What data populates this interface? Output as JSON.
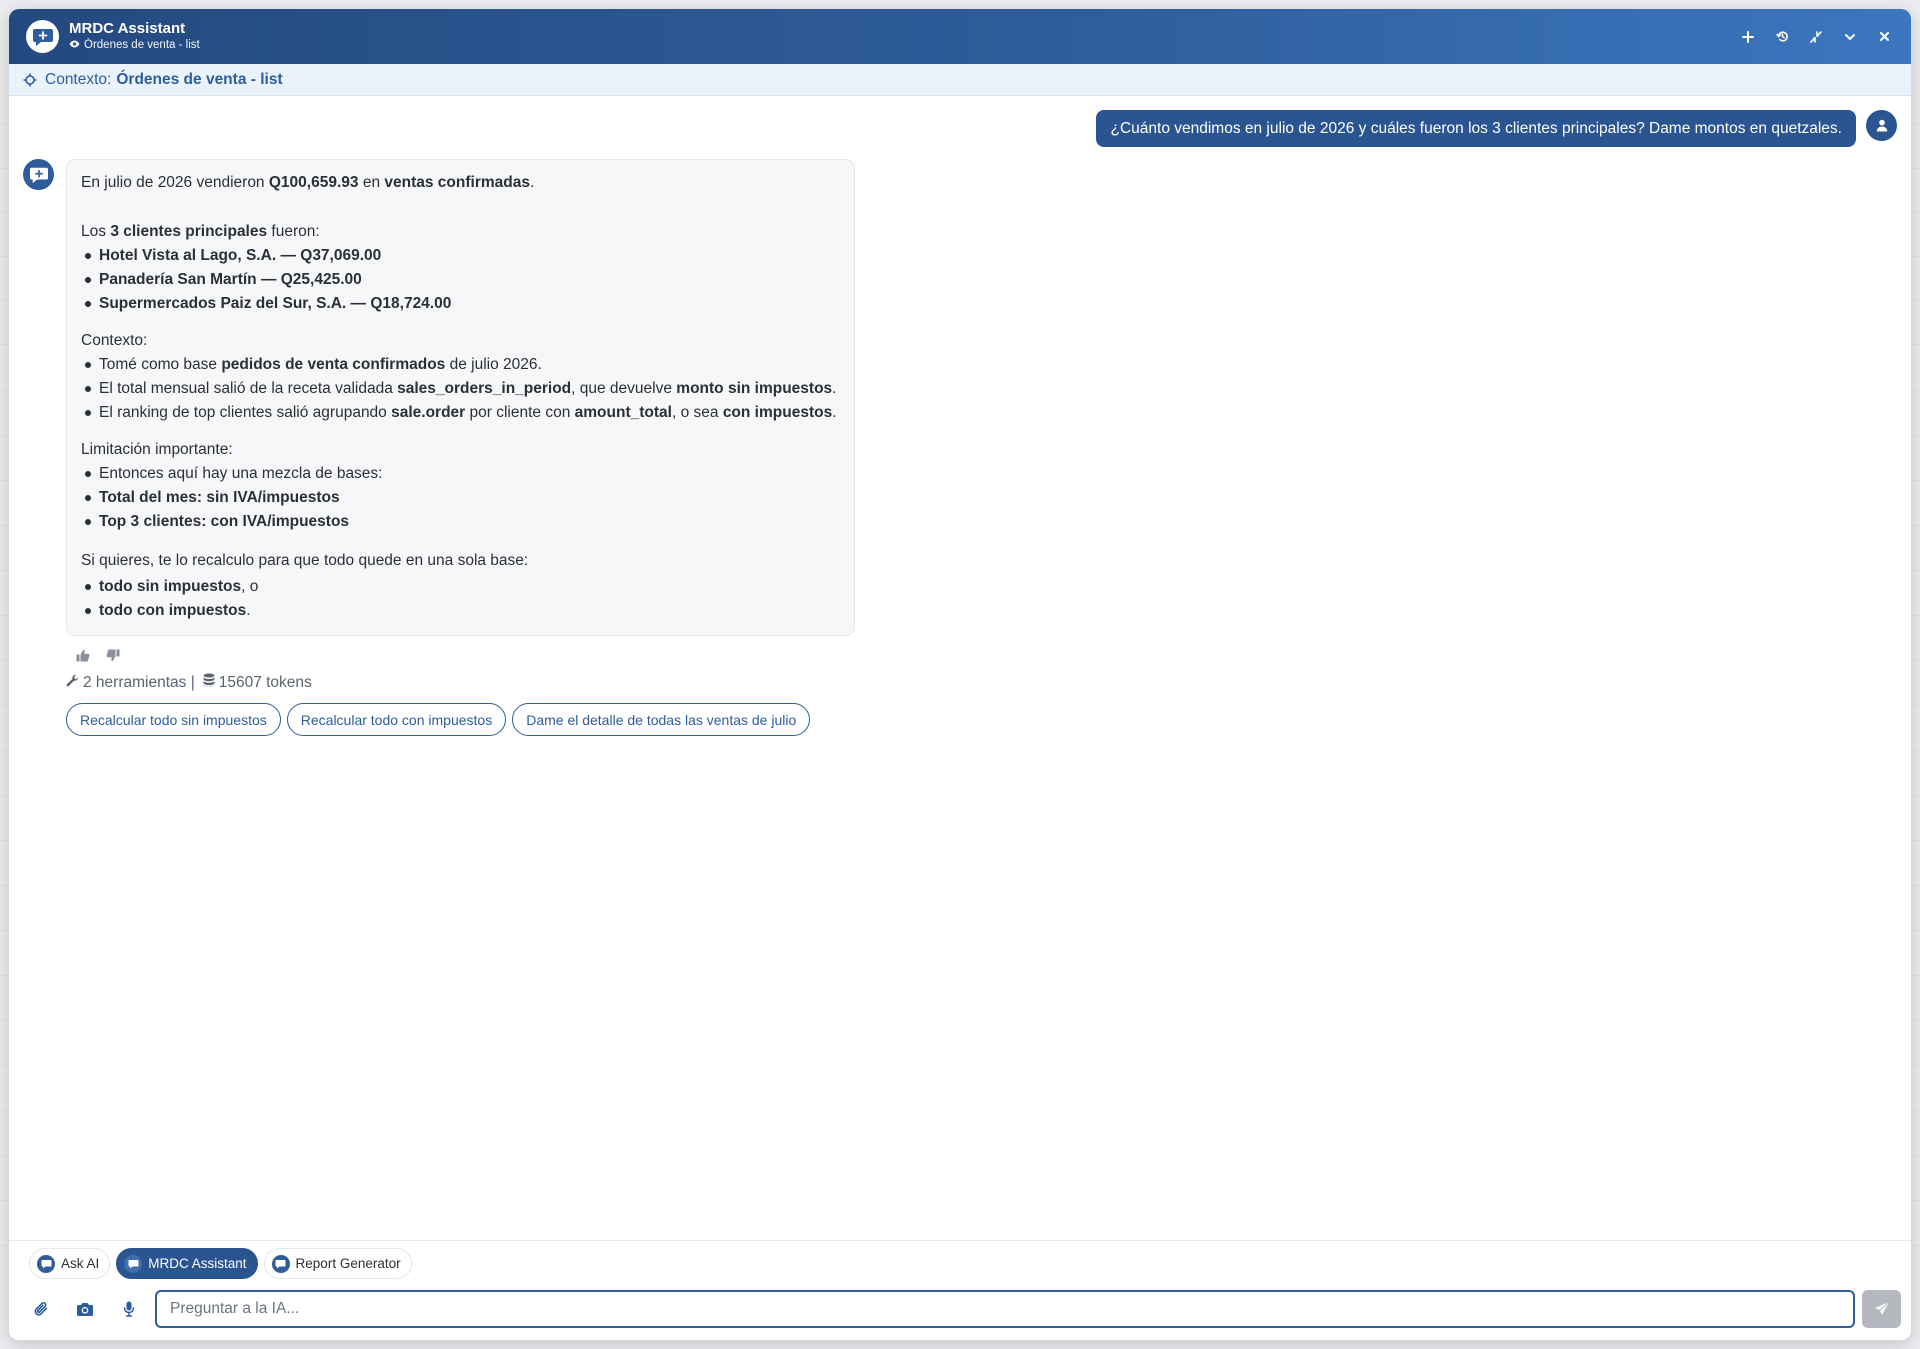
{
  "window": {
    "title": "MRDC Assistant",
    "subtitle": "Órdenes de venta - list"
  },
  "context": {
    "label": "Contexto:",
    "value": "Órdenes de venta - list"
  },
  "user_message": "¿Cuánto vendimos en julio de 2026 y cuáles fueron los 3 clientes principales? Dame montos en quetzales.",
  "bot_message": {
    "intro": {
      "p1": "En julio de 2026 vendieron ",
      "b1": "Q100,659.93",
      "p2": " en ",
      "b2": "ventas confirmadas",
      "p3": "."
    },
    "top_intro": {
      "p1": "Los ",
      "b1": "3 clientes principales",
      "p2": " fueron:"
    },
    "top_clients": [
      "Hotel Vista al Lago, S.A. — Q37,069.00",
      "Panadería San Martín — Q25,425.00",
      "Supermercados Paiz del Sur, S.A. — Q18,724.00"
    ],
    "context_heading": "Contexto:",
    "context_items": [
      {
        "t1": "Tomé como base ",
        "b1": "pedidos de venta confirmados",
        "t2": " de julio 2026.",
        "b2": "",
        "t3": "",
        "b3": "",
        "t4": ""
      },
      {
        "t1": "El total mensual salió de la receta validada ",
        "b1": "sales_orders_in_period",
        "t2": ", que devuelve ",
        "b2": "monto sin impuestos",
        "t3": ".",
        "b3": "",
        "t4": ""
      },
      {
        "t1": "El ranking de top clientes salió agrupando ",
        "b1": "sale.order",
        "t2": " por cliente con ",
        "b2": "amount_total",
        "t3": ", o sea ",
        "b3": "con impuestos",
        "t4": "."
      }
    ],
    "limitation_heading": "Limitación importante:",
    "limitation_items": {
      "item1": "Entonces aquí hay una mezcla de bases:",
      "item2": "Total del mes: sin IVA/impuestos",
      "item3": "Top 3 clientes: con IVA/impuestos"
    },
    "offer": "Si quieres, te lo recalculo para que todo quede en una sola base:",
    "offer_items": [
      {
        "bold": "todo sin impuestos",
        "rest": ", o"
      },
      {
        "bold": "todo con impuestos",
        "rest": "."
      }
    ]
  },
  "meta": {
    "tools": "2 herramientas |",
    "tokens": "15607 tokens"
  },
  "suggestions": [
    "Recalcular todo sin impuestos",
    "Recalcular todo con impuestos",
    "Dame el detalle de todas las ventas de julio"
  ],
  "agent_tabs": [
    {
      "label": "Ask AI",
      "active": false
    },
    {
      "label": "MRDC Assistant",
      "active": true
    },
    {
      "label": "Report Generator",
      "active": false
    }
  ],
  "composer": {
    "placeholder": "Preguntar a la IA..."
  },
  "colors": {
    "brand": "#2a5590",
    "header_gradient_start": "#24497f",
    "header_gradient_end": "#3b76bf",
    "send_disabled": "#b5b9bf"
  },
  "icons": {
    "title": "chat-plus-icon",
    "subtitle": "eye-icon",
    "actions": [
      "plus-icon",
      "history-icon",
      "collapse-icon",
      "chevron-down-icon",
      "close-icon"
    ],
    "context": "crosshair-icon",
    "user": "user-icon",
    "feedback": [
      "thumbs-up-icon",
      "thumbs-down-icon"
    ],
    "meta": [
      "wrench-icon",
      "database-icon"
    ],
    "composer": [
      "paperclip-icon",
      "camera-icon",
      "microphone-icon",
      "send-icon"
    ]
  }
}
